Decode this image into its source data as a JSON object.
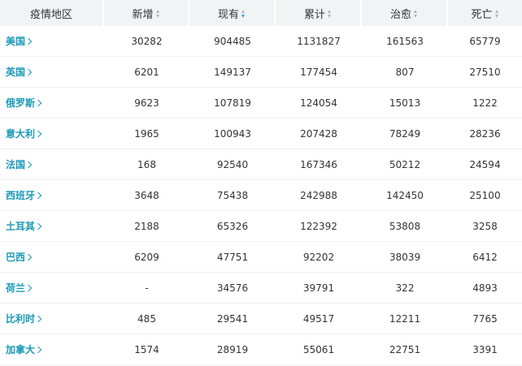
{
  "table": {
    "headers": [
      {
        "label": "疫情地区",
        "sortable": false,
        "active": false
      },
      {
        "label": "新增",
        "sortable": true,
        "active": false
      },
      {
        "label": "现有",
        "sortable": true,
        "active": true
      },
      {
        "label": "累计",
        "sortable": true,
        "active": false
      },
      {
        "label": "治愈",
        "sortable": true,
        "active": false
      },
      {
        "label": "死亡",
        "sortable": true,
        "active": false
      }
    ],
    "rows": [
      {
        "area": "美国",
        "new": "30282",
        "current": "904485",
        "total": "1131827",
        "cured": "161563",
        "dead": "65779"
      },
      {
        "area": "英国",
        "new": "6201",
        "current": "149137",
        "total": "177454",
        "cured": "807",
        "dead": "27510"
      },
      {
        "area": "俄罗斯",
        "new": "9623",
        "current": "107819",
        "total": "124054",
        "cured": "15013",
        "dead": "1222"
      },
      {
        "area": "意大利",
        "new": "1965",
        "current": "100943",
        "total": "207428",
        "cured": "78249",
        "dead": "28236"
      },
      {
        "area": "法国",
        "new": "168",
        "current": "92540",
        "total": "167346",
        "cured": "50212",
        "dead": "24594"
      },
      {
        "area": "西班牙",
        "new": "3648",
        "current": "75438",
        "total": "242988",
        "cured": "142450",
        "dead": "25100"
      },
      {
        "area": "土耳其",
        "new": "2188",
        "current": "65326",
        "total": "122392",
        "cured": "53808",
        "dead": "3258"
      },
      {
        "area": "巴西",
        "new": "6209",
        "current": "47751",
        "total": "92202",
        "cured": "38039",
        "dead": "6412"
      },
      {
        "area": "荷兰",
        "new": "-",
        "current": "34576",
        "total": "39791",
        "cured": "322",
        "dead": "4893"
      },
      {
        "area": "比利时",
        "new": "485",
        "current": "29541",
        "total": "49517",
        "cured": "12211",
        "dead": "7765"
      },
      {
        "area": "加拿大",
        "new": "1574",
        "current": "28919",
        "total": "55061",
        "cured": "22751",
        "dead": "3391"
      }
    ]
  },
  "colors": {
    "header_bg": "#f2f3f5",
    "area_link": "#1c9ab8",
    "sort_active": "#29a8d6",
    "sort_inactive": "#b0b4ba",
    "row_divider": "#eef0f2"
  },
  "icons": {
    "sort": "sort-caret-icon",
    "area_link": "chevron-right-icon"
  }
}
